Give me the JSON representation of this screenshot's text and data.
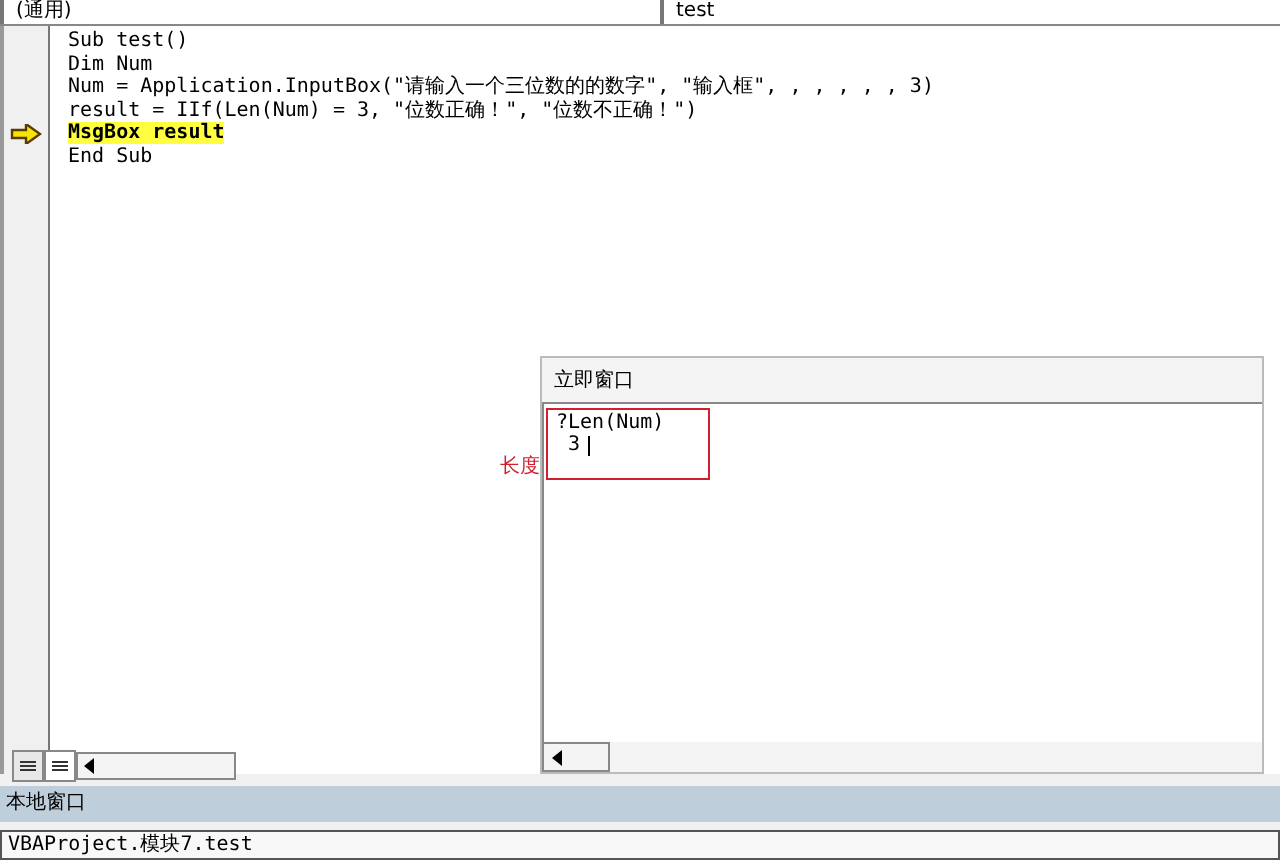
{
  "dropdowns": [
    {
      "value": "(通用)"
    },
    {
      "value": "test"
    }
  ],
  "code_lines": [
    {
      "text": "Sub test()",
      "current": false
    },
    {
      "text": "Dim Num",
      "current": false
    },
    {
      "text": "Num = Application.InputBox(\"请输入一个三位数的的数字\", \"输入框\", , , , , , 3)",
      "current": false
    },
    {
      "text": "result = IIf(Len(Num) = 3, \"位数正确！\", \"位数不正确！\")",
      "current": false
    },
    {
      "text": "MsgBox result",
      "current": true
    },
    {
      "text": "End Sub",
      "current": false
    }
  ],
  "immediate_window": {
    "title": "立即窗口",
    "lines": [
      "?Len(Num)",
      "3"
    ]
  },
  "annotation": {
    "label": "长度"
  },
  "locals_window": {
    "title": "本地窗口"
  },
  "locals_context": {
    "value": "VBAProject.模块7.test"
  }
}
